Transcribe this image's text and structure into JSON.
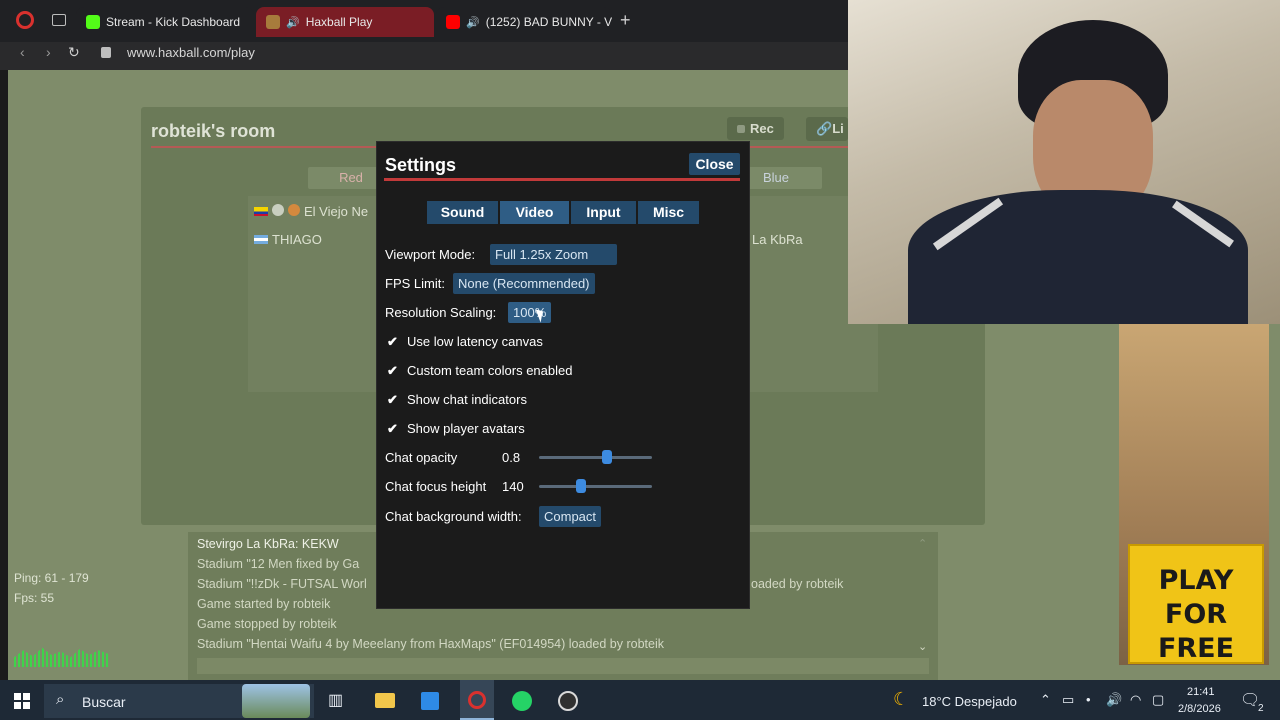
{
  "browser": {
    "tabs": [
      {
        "label": "Stream - Kick Dashboard",
        "favicon": "kick-icon"
      },
      {
        "label": "Haxball Play",
        "favicon": "haxball-icon"
      },
      {
        "label": "(1252) BAD BUNNY - V",
        "favicon": "youtube-icon"
      }
    ],
    "new_tab": "+",
    "url": "www.haxball.com/play"
  },
  "room": {
    "title": "robteik's room",
    "rec_label": "Rec",
    "link_label": "Li",
    "red_label": "Red",
    "blue_label": "Blue",
    "players": [
      "El Viejo Ne",
      "THIAGO",
      "La KbRa"
    ]
  },
  "settings": {
    "title": "Settings",
    "close_label": "Close",
    "tabs": [
      "Sound",
      "Video",
      "Input",
      "Misc"
    ],
    "viewport_label": "Viewport Mode:",
    "viewport_value": "Full 1.25x Zoom",
    "fps_label": "FPS Limit:",
    "fps_value": "None (Recommended)",
    "resolution_label": "Resolution Scaling:",
    "resolution_value": "100%",
    "checks": [
      "Use low latency canvas",
      "Custom team colors enabled",
      "Show chat indicators",
      "Show player avatars"
    ],
    "opacity_label": "Chat opacity",
    "opacity_value": "0.8",
    "opacity_fraction": 0.6,
    "focus_label": "Chat focus height",
    "focus_value": "140",
    "focus_fraction": 0.37,
    "bgwidth_label": "Chat background width:",
    "bgwidth_value": "Compact"
  },
  "chat": {
    "lines": [
      "Stevirgo La KbRa: KEKW",
      "Stadium \"12 Men fixed by Ga",
      "Stadium \"!!zDk - FUTSAL Worl",
      "Game started by robteik",
      "Game stopped by robteik",
      "Stadium \"Hentai Waifu 4 by Meeelany from HaxMaps\" (EF014954) loaded by robteik"
    ],
    "overflow_text": "oaded by robteik"
  },
  "stats": {
    "ping": "Ping: 61 - 179",
    "fps": "Fps: 55"
  },
  "ad": {
    "text_line1": "PLAY",
    "text_line2": "FOR FREE"
  },
  "taskbar": {
    "search_placeholder": "Buscar",
    "weather": "18°C  Despejado",
    "time": "21:41",
    "date": "2/8/2026",
    "notifications": "2"
  },
  "colors": {
    "accent": "#244a6b",
    "red_line": "#c23a3a",
    "slider": "#3d8be0"
  }
}
